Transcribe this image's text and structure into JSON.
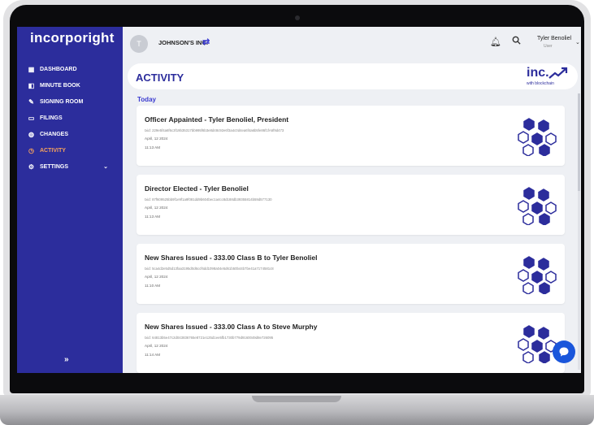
{
  "app": {
    "logo_text": "incorporight",
    "company": "JOHNSON'S INC.",
    "avatar_initials": "T"
  },
  "sidebar": {
    "items": [
      {
        "label": "DASHBOARD",
        "icon": "dashboard-icon"
      },
      {
        "label": "MINUTE BOOK",
        "icon": "book-icon"
      },
      {
        "label": "SIGNING ROOM",
        "icon": "pen-icon"
      },
      {
        "label": "FILINGS",
        "icon": "folder-icon"
      },
      {
        "label": "CHANGES",
        "icon": "changes-icon"
      },
      {
        "label": "ACTIVITY",
        "icon": "activity-icon",
        "active": true
      },
      {
        "label": "SETTINGS",
        "icon": "gear-icon",
        "has_submenu": true
      }
    ],
    "collapse_label": "»"
  },
  "user": {
    "name": "Tyler Benoliel",
    "role": "User"
  },
  "page": {
    "title": "ACTIVITY",
    "brand_main": "inc.",
    "brand_sub": "with blockchain",
    "section_label": "Today"
  },
  "activities": [
    {
      "title": "Officer Appainted - Tyler Benoliel, President",
      "hash": "txid: 229e5f4a6f6c3f19b35317bb995f6b3e8d48c92e6f3a4c0d4ea6f4a6b5fe86f1fA6f9d473",
      "date": "April, 12 2024",
      "time": "11:13 AM"
    },
    {
      "title": "Director Elected - Tyler Benoliel",
      "hash": "txid: 87f609525bb9f1e9f1a9f081dd9b604bec1a4cc8d188db39355814b59d577130",
      "date": "April, 12 2024",
      "time": "11:13 AM"
    },
    {
      "title": "New Shares Issued - 333.00 Class B to Tyler Benoliel",
      "hash": "txid: 5ca4d2e5d5d13faa3195d0d6ccf6dd1098a04e5d61b50b44b7be41a7174581c8",
      "date": "April, 12 2024",
      "time": "11:10 AM"
    },
    {
      "title": "New Shares Issued - 333.00 Class A to Steve Murphy",
      "hash": "txid: 64813b5e47c2d043836765e8721e125d1ee5fb1730b779d9160049d8e726095",
      "date": "April, 12 2024",
      "time": "11:14 AM"
    }
  ],
  "colors": {
    "sidebar_bg": "#2c2d9c",
    "active_nav": "#f7a35c",
    "accent": "#3a3ad0",
    "chat_button": "#1a56db"
  }
}
